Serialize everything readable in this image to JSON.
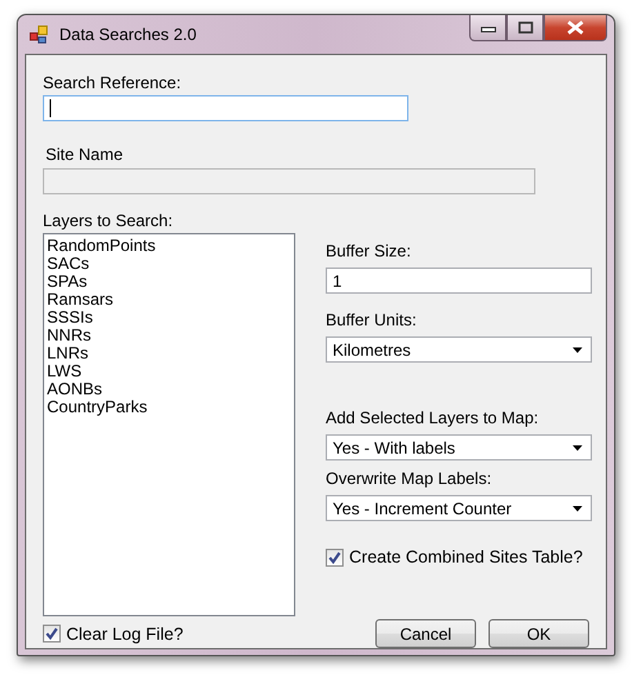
{
  "window": {
    "title": "Data Searches 2.0"
  },
  "search_reference": {
    "label": "Search Reference:",
    "focused": true
  },
  "site_name": {
    "label": "Site Name",
    "disabled": true
  },
  "layers": {
    "label": "Layers to Search:",
    "items": [
      "RandomPoints",
      "SACs",
      "SPAs",
      "Ramsars",
      "SSSIs",
      "NNRs",
      "LNRs",
      "LWS",
      "AONBs",
      "CountryParks"
    ]
  },
  "buffer_size": {
    "label": "Buffer Size:",
    "value": "1"
  },
  "buffer_units": {
    "label": "Buffer Units:",
    "value": "Kilometres"
  },
  "add_layers": {
    "label": "Add Selected Layers to Map:",
    "value": "Yes - With labels"
  },
  "overwrite_labels": {
    "label": "Overwrite Map Labels:",
    "value": "Yes - Increment Counter"
  },
  "combined_table": {
    "label": "Create Combined Sites Table?",
    "checked": true
  },
  "clear_log": {
    "label": "Clear Log File?",
    "checked": true
  },
  "buttons": [
    {
      "label": "Cancel"
    },
    {
      "label": "OK"
    }
  ]
}
